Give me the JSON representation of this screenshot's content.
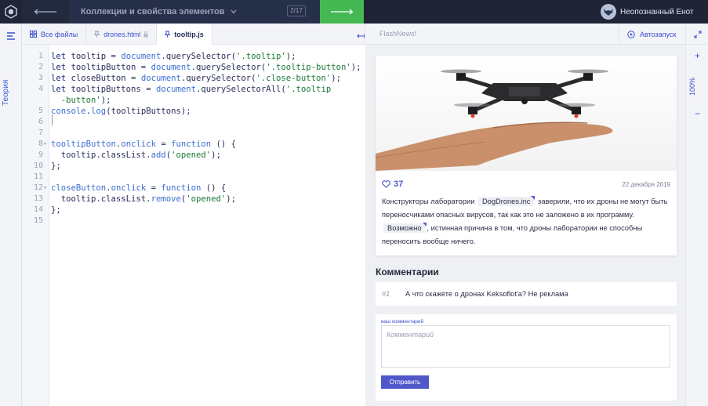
{
  "topbar": {
    "back_icon": "arrow-left-icon",
    "breadcrumb": "Коллекции и свойства элементов",
    "counter": "2/17",
    "next_icon": "arrow-right-icon",
    "user_name": "Неопознанный Енот",
    "accent_green": "#45b854"
  },
  "rail": {
    "theory_label": "Теория"
  },
  "tabs": [
    {
      "label": "Все файлы",
      "icon": "grid-icon"
    },
    {
      "label": "drones.html",
      "icon": "pin-icon",
      "locked": true
    },
    {
      "label": "tooltip.js",
      "icon": "pin-icon",
      "active": true
    }
  ],
  "editor": {
    "line_numbers": [
      "1",
      "2",
      "3",
      "4",
      "",
      "5",
      "6",
      "7",
      "8",
      "9",
      "10",
      "11",
      "12",
      "13",
      "14",
      "15"
    ],
    "language": "javascript"
  },
  "preview": {
    "address": "FlashNews!",
    "autorun_label": "Автозапуск",
    "zoom_plus": "+",
    "zoom_level": "100%",
    "zoom_minus": "−"
  },
  "post": {
    "likes": "37",
    "date": "22 декабря 2019",
    "text_1": "Конструкторы лаборатории ",
    "tag_1": "DogDrones.inc",
    "text_2": " заверили, что их дроны не могут быть переносчиками опасных вирусов, так как это не заложено в их программу. ",
    "tag_2": "Возможно",
    "text_3": ", истинная причина в том, что дроны лаборатории не способны переносить вообще ничего."
  },
  "comments": {
    "title": "Комментарии",
    "items": [
      {
        "num": "#1",
        "text": "А что скажете о дронах Keksoflot'a? Не реклама"
      }
    ],
    "form_label": "ваш комментарий",
    "placeholder": "Комментарий",
    "submit_label": "Отправить"
  }
}
